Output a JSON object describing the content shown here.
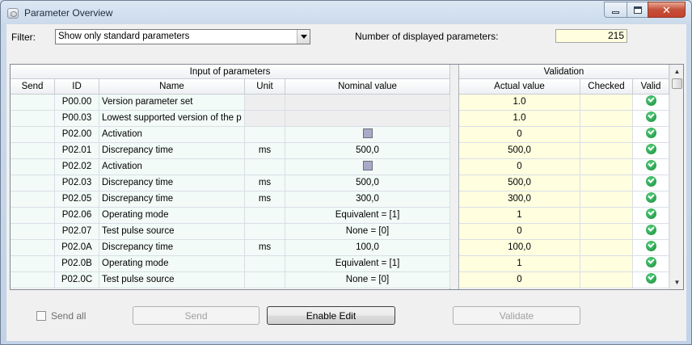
{
  "window": {
    "title": "Parameter Overview"
  },
  "filter": {
    "label": "Filter:",
    "value": "Show only standard parameters"
  },
  "count": {
    "label": "Number of displayed parameters:",
    "value": "215"
  },
  "table": {
    "groups": {
      "input": "Input of parameters",
      "validation": "Validation"
    },
    "columns": {
      "send": "Send",
      "id": "ID",
      "name": "Name",
      "unit": "Unit",
      "nominal": "Nominal value",
      "actual": "Actual value",
      "checked": "Checked",
      "valid": "Valid"
    },
    "rows": [
      {
        "id": "P00.00",
        "name": "Version parameter set",
        "unit": "",
        "nominal": "",
        "nominal_checkbox": false,
        "actual": "1.0",
        "inactive": true
      },
      {
        "id": "P00.03",
        "name": "Lowest supported version of the p",
        "unit": "",
        "nominal": "",
        "nominal_checkbox": false,
        "actual": "1.0",
        "inactive": true
      },
      {
        "id": "P02.00",
        "name": "Activation",
        "unit": "",
        "nominal": "",
        "nominal_checkbox": true,
        "actual": "0"
      },
      {
        "id": "P02.01",
        "name": "Discrepancy time",
        "unit": "ms",
        "nominal": "500,0",
        "nominal_checkbox": false,
        "actual": "500,0"
      },
      {
        "id": "P02.02",
        "name": "Activation",
        "unit": "",
        "nominal": "",
        "nominal_checkbox": true,
        "actual": "0"
      },
      {
        "id": "P02.03",
        "name": "Discrepancy time",
        "unit": "ms",
        "nominal": "500,0",
        "nominal_checkbox": false,
        "actual": "500,0"
      },
      {
        "id": "P02.05",
        "name": "Discrepancy time",
        "unit": "ms",
        "nominal": "300,0",
        "nominal_checkbox": false,
        "actual": "300,0"
      },
      {
        "id": "P02.06",
        "name": "Operating mode",
        "unit": "",
        "nominal": "Equivalent = [1]",
        "nominal_checkbox": false,
        "actual": "1"
      },
      {
        "id": "P02.07",
        "name": "Test pulse source",
        "unit": "",
        "nominal": "None = [0]",
        "nominal_checkbox": false,
        "actual": "0"
      },
      {
        "id": "P02.0A",
        "name": "Discrepancy time",
        "unit": "ms",
        "nominal": "100,0",
        "nominal_checkbox": false,
        "actual": "100,0"
      },
      {
        "id": "P02.0B",
        "name": "Operating mode",
        "unit": "",
        "nominal": "Equivalent = [1]",
        "nominal_checkbox": false,
        "actual": "1"
      },
      {
        "id": "P02.0C",
        "name": "Test pulse source",
        "unit": "",
        "nominal": "None = [0]",
        "nominal_checkbox": false,
        "actual": "0"
      }
    ]
  },
  "footer": {
    "send_all_label": "Send all",
    "send_label": "Send",
    "enable_edit_label": "Enable Edit",
    "validate_label": "Validate"
  },
  "colors": {
    "input_cell": "#f2fbf7",
    "validation_cell": "#ffffe0",
    "valid_ok": "#148a37"
  },
  "icons": {
    "valid": "check-circle-icon",
    "window": "app-icon"
  }
}
